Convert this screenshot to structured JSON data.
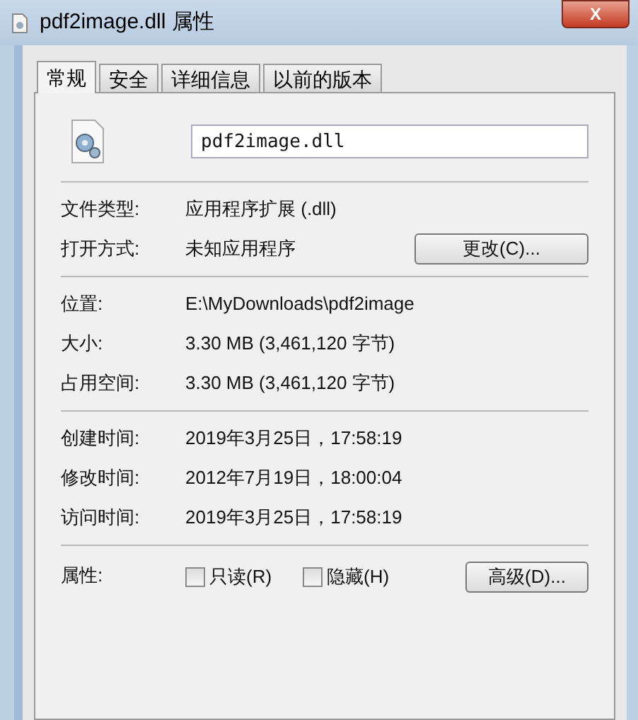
{
  "window": {
    "title": "pdf2image.dll 属性",
    "close": "X"
  },
  "tabs": [
    {
      "label": "常规",
      "selected": true
    },
    {
      "label": "安全",
      "selected": false
    },
    {
      "label": "详细信息",
      "selected": false
    },
    {
      "label": "以前的版本",
      "selected": false
    }
  ],
  "file_name": {
    "value": "pdf2image.dll"
  },
  "sections": [
    [
      {
        "label": "文件类型:",
        "value": "应用程序扩展 (.dll)"
      },
      {
        "label": "打开方式:",
        "value": "未知应用程序",
        "button": "更改(C)..."
      }
    ],
    [
      {
        "label": "位置:",
        "value": "E:\\MyDownloads\\pdf2image"
      },
      {
        "label": "大小:",
        "value": "3.30 MB (3,461,120 字节)"
      },
      {
        "label": "占用空间:",
        "value": "3.30 MB (3,461,120 字节)"
      }
    ],
    [
      {
        "label": "创建时间:",
        "value": "2019年3月25日，17:58:19"
      },
      {
        "label": "修改时间:",
        "value": "2012年7月19日，18:00:04"
      },
      {
        "label": "访问时间:",
        "value": "2019年3月25日，17:58:19"
      }
    ]
  ],
  "attributes": {
    "label": "属性:",
    "checkboxes": [
      {
        "label": "只读(R)",
        "checked": false
      },
      {
        "label": "隐藏(H)",
        "checked": false
      }
    ],
    "button": "高级(D)..."
  }
}
